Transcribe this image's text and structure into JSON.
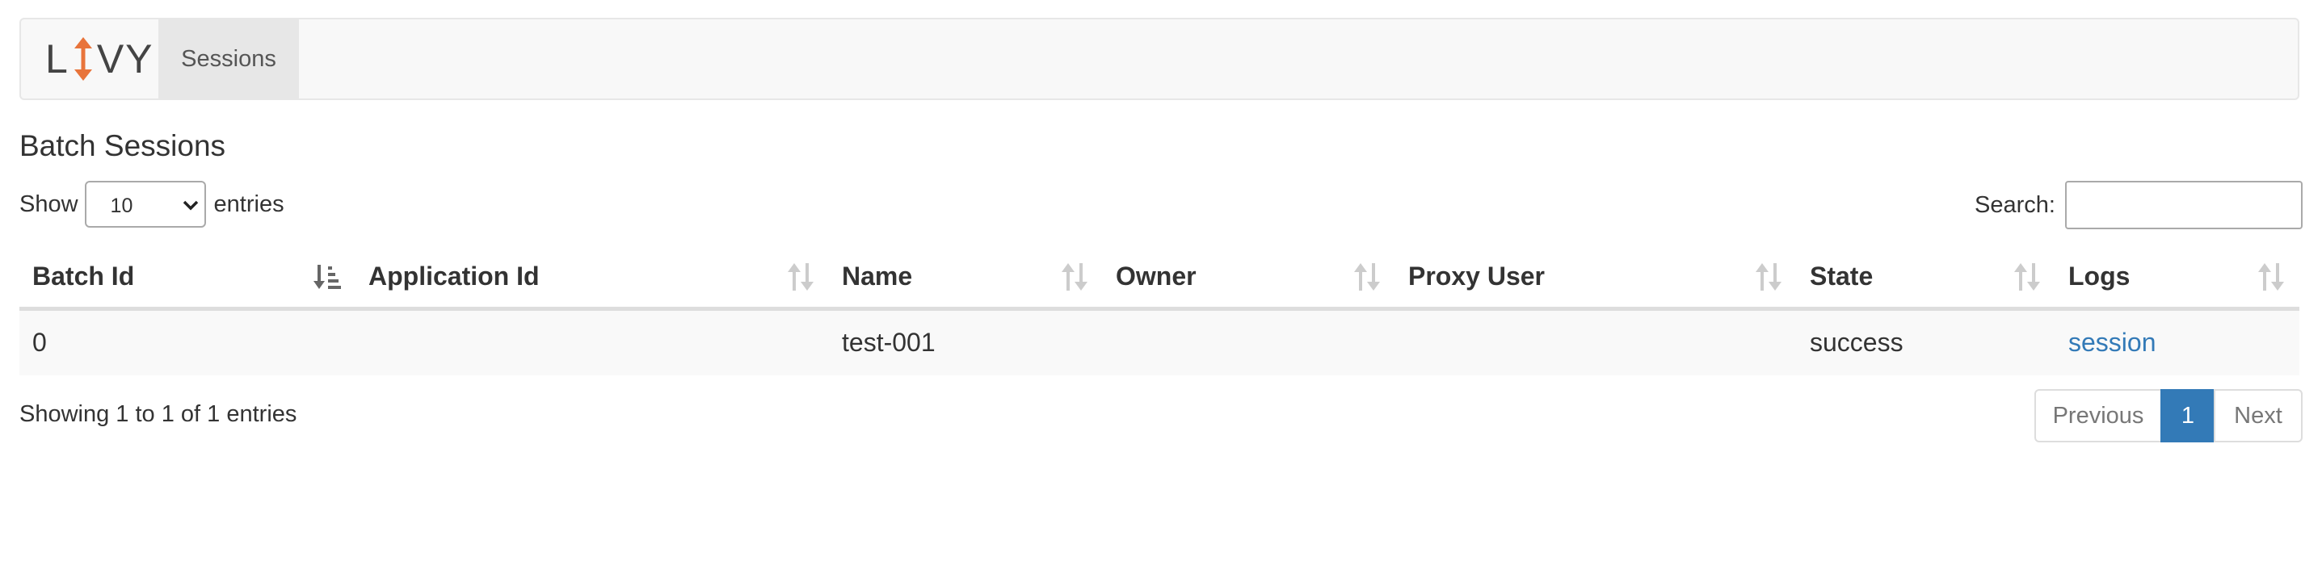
{
  "nav": {
    "brand_left": "L",
    "brand_right": "VY",
    "sessions_label": "Sessions"
  },
  "page": {
    "title": "Batch Sessions"
  },
  "length": {
    "show_label": "Show",
    "value": "10",
    "entries_label": "entries"
  },
  "search": {
    "label": "Search:",
    "value": ""
  },
  "table": {
    "columns": [
      "Batch Id",
      "Application Id",
      "Name",
      "Owner",
      "Proxy User",
      "State",
      "Logs"
    ],
    "rows": [
      {
        "batch_id": "0",
        "application_id": "",
        "name": "test-001",
        "owner": "",
        "proxy_user": "",
        "state": "success",
        "logs": "session"
      }
    ]
  },
  "info": "Showing 1 to 1 of 1 entries",
  "pagination": {
    "previous": "Previous",
    "current": "1",
    "next": "Next"
  },
  "colors": {
    "link": "#337ab7",
    "brand_accent": "#e8743b",
    "navbar_bg": "#f8f8f8"
  },
  "icons": {
    "sorted_column": "sort-amount-asc-icon",
    "other_columns": "sort-both-icon",
    "select_arrow": "chevron-down-icon"
  }
}
